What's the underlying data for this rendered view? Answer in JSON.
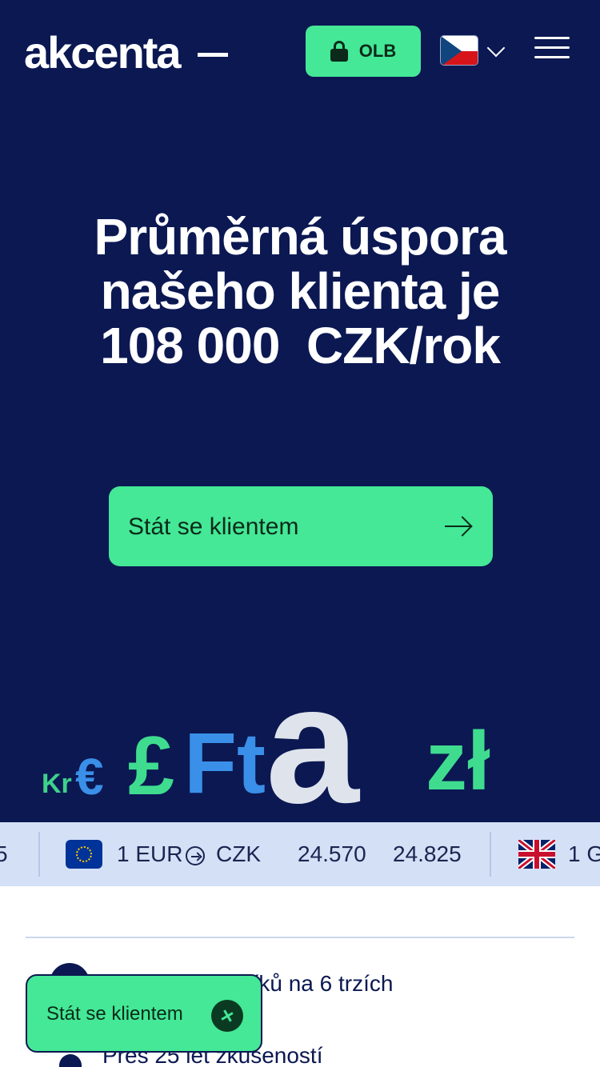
{
  "header": {
    "logo": "akcenta",
    "olb_label": "OLB",
    "language": "cz-flag-icon",
    "menu_icon": "hamburger-icon"
  },
  "hero": {
    "headline_line1": "Průměrná úspora",
    "headline_line2": "našeho klienta je",
    "headline_line3": "108 000  CZK/rok",
    "cta_label": "Stát se klientem",
    "art": {
      "kr": "Kr",
      "eur": "€",
      "gbp": "£",
      "ft": "Ft",
      "a": "a",
      "zl": "zł"
    }
  },
  "ticker": {
    "prev_fragment": "5",
    "item": {
      "flag": "eu-flag-icon",
      "pair_from": "1 EUR",
      "pair_to": "CZK",
      "buy": "24.570",
      "sell": "24.825"
    },
    "next_fragment": "1 G"
  },
  "features": [
    {
      "text": "níků na 6 trzích"
    },
    {
      "text": "Přes 25 let zkušeností"
    }
  ],
  "floating_cta": {
    "label": "Stát se klientem"
  },
  "colors": {
    "navy": "#0b1852",
    "green": "#44e896",
    "ticker_bg": "#d3e0f6"
  }
}
